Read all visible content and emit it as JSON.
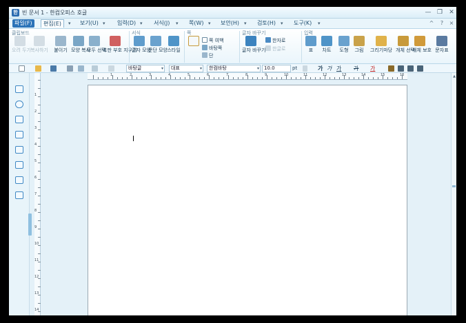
{
  "window": {
    "title": "빈 문서 1 - 한컴오피스 호글",
    "app_icon": "한",
    "minimize": "—",
    "restore": "❐",
    "close": "✕"
  },
  "menu": {
    "items": [
      "파일(F)",
      "편집(E)",
      "보기(U)",
      "입력(D)",
      "서식(J)",
      "쪽(W)",
      "보안(H)",
      "검토(H)",
      "도구(K)"
    ],
    "right": [
      "^",
      "?",
      "×"
    ]
  },
  "ribbon": {
    "groups": {
      "clipboard": "클립보드",
      "format": "서식",
      "page": "쪽",
      "find_replace": "글자 바꾸기",
      "insert": "입력"
    },
    "buttons": {
      "cut": "오려 두기",
      "copy": "복사하기",
      "paste": "붙이기",
      "format_copy": "모양 복사",
      "select_all": "모두 선택",
      "clear_mark": "조판 부호 지우기",
      "char_shape": "글자 모양",
      "para_shape": "문단 모양",
      "style": "스타일",
      "page_margin": "쪽 여백",
      "page_bg": "바탕쪽",
      "columns": "단",
      "char_replace": "글자 바꾸기",
      "hanja": "한자로",
      "hanja2": "한글로",
      "table": "표",
      "chart": "차트",
      "shape": "도형",
      "picture": "그림",
      "drawing": "그리기마당",
      "object_select": "개체 선택",
      "object_protect": "개체 보호",
      "char_map": "문자표"
    }
  },
  "format_bar": {
    "style": "바탕글",
    "lang": "대표",
    "font": "한컴바탕",
    "size": "10.0",
    "unit": "pt",
    "bold": "가",
    "italic": "가",
    "underline": "가",
    "strike": "가",
    "color": "가"
  },
  "ruler": {
    "h_numbers": [
      "1",
      "2",
      "3",
      "4",
      "5",
      "6",
      "7",
      "8",
      "9",
      "10",
      "11",
      "12",
      "13",
      "14",
      "15",
      "16"
    ],
    "v_numbers": [
      "1",
      "2",
      "3",
      "4",
      "5",
      "6",
      "7",
      "8",
      "9",
      "10",
      "11",
      "12",
      "13",
      "14"
    ]
  },
  "colors": {
    "accent": "#2b73b8",
    "chrome": "#e4f1f8",
    "page": "#ffffff"
  }
}
